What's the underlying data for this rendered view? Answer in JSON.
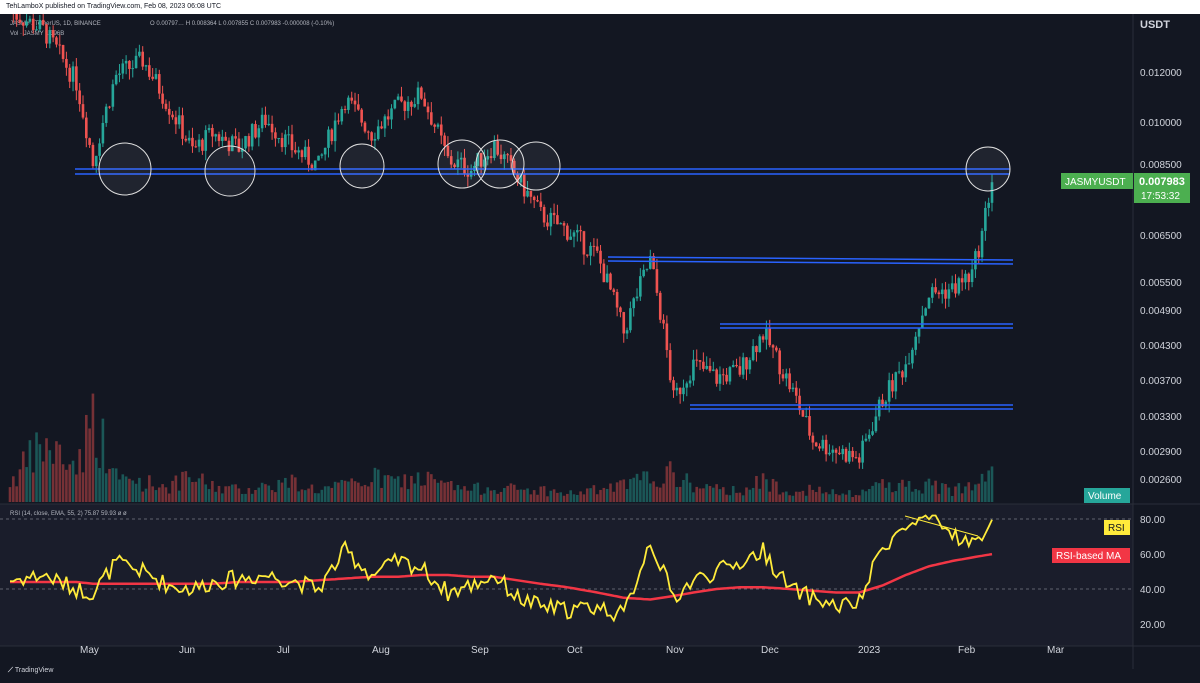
{
  "header": {
    "publisher": "TehLamboX published on TradingView.com, Feb 08, 2023 06:08 UTC",
    "symbol_line": "JASMY / TetherUS, 1D, BINANCE",
    "ohlc_line": "O 0.00797…  H 0.008364  L 0.007855  C 0.007983  -0.000008 (-0.10%)",
    "vol_line": "Vol · JASMY  1.396B",
    "currency": "USDT"
  },
  "price_axis": {
    "labels": [
      "0.012000",
      "0.010000",
      "0.008500",
      "0.006500",
      "0.005500",
      "0.004900",
      "0.004300",
      "0.003700",
      "0.003300",
      "0.002900",
      "0.002600"
    ]
  },
  "badges": {
    "symbol": "JASMYUSDT",
    "price": "0.007983",
    "countdown": "17:53:32",
    "volume": "Volume",
    "rsi": "RSI",
    "rsi_ma": "RSI-based MA",
    "symbol_color": "#4caf50",
    "volume_color": "#26a69a",
    "rsi_color": "#ffeb3b",
    "rsi_ma_color": "#f23645"
  },
  "rsi_header": "RSI (14, close, EMA, 55, 2)  75.87  59.93  ø  ø",
  "rsi_axis": {
    "labels": [
      "80.00",
      "60.00",
      "40.00",
      "20.00"
    ]
  },
  "time_axis": {
    "labels": [
      "May",
      "Jun",
      "Jul",
      "Aug",
      "Sep",
      "Oct",
      "Nov",
      "Dec",
      "2023",
      "Feb",
      "Mar"
    ]
  },
  "footer": {
    "brand": "TradingView"
  },
  "chart_data": {
    "type": "candlestick",
    "title": "JASMY / TetherUS, 1D, BINANCE",
    "price_scale": "log",
    "x": [
      "2022-04-18",
      "2022-04-28",
      "2022-05-08",
      "2022-05-13",
      "2022-05-20",
      "2022-05-28",
      "2022-06-05",
      "2022-06-12",
      "2022-06-18",
      "2022-06-26",
      "2022-07-04",
      "2022-07-12",
      "2022-07-20",
      "2022-07-28",
      "2022-08-05",
      "2022-08-13",
      "2022-08-20",
      "2022-08-28",
      "2022-09-04",
      "2022-09-11",
      "2022-09-18",
      "2022-09-25",
      "2022-10-03",
      "2022-10-12",
      "2022-10-20",
      "2022-10-28",
      "2022-11-04",
      "2022-11-10",
      "2022-11-17",
      "2022-11-24",
      "2022-12-01",
      "2022-12-09",
      "2022-12-16",
      "2022-12-23",
      "2022-12-30",
      "2023-01-06",
      "2023-01-13",
      "2023-01-20",
      "2023-01-27",
      "2023-02-02",
      "2023-02-05",
      "2023-02-08"
    ],
    "close": [
      0.015,
      0.014,
      0.0115,
      0.0085,
      0.0118,
      0.0125,
      0.0105,
      0.0089,
      0.0095,
      0.009,
      0.01,
      0.009,
      0.0084,
      0.0108,
      0.0095,
      0.0105,
      0.011,
      0.0086,
      0.0083,
      0.0091,
      0.008,
      0.007,
      0.0066,
      0.006,
      0.0045,
      0.0059,
      0.0035,
      0.004,
      0.0038,
      0.0039,
      0.0045,
      0.0037,
      0.003,
      0.0029,
      0.0028,
      0.0035,
      0.004,
      0.0052,
      0.0053,
      0.0056,
      0.0065,
      0.008
    ],
    "volume": [
      0.5,
      1.4,
      0.9,
      2.1,
      0.6,
      0.5,
      0.4,
      0.6,
      0.4,
      0.3,
      0.4,
      0.5,
      0.3,
      0.4,
      0.6,
      0.5,
      0.6,
      0.4,
      0.3,
      0.4,
      0.3,
      0.3,
      0.2,
      0.3,
      0.4,
      0.6,
      0.7,
      0.4,
      0.3,
      0.3,
      0.5,
      0.3,
      0.3,
      0.2,
      0.2,
      0.5,
      0.4,
      0.4,
      0.3,
      0.5,
      1.0,
      0.9
    ],
    "rsi": [
      45,
      48,
      40,
      38,
      55,
      50,
      42,
      40,
      44,
      46,
      48,
      45,
      40,
      62,
      48,
      56,
      52,
      38,
      42,
      48,
      35,
      30,
      28,
      30,
      25,
      68,
      35,
      45,
      50,
      55,
      62,
      40,
      35,
      30,
      32,
      65,
      75,
      80,
      72,
      65,
      72,
      75.87
    ],
    "rsi_ma": [
      44,
      44,
      44,
      43,
      43,
      43,
      43,
      43,
      43,
      44,
      44,
      44,
      45,
      46,
      47,
      47,
      48,
      48,
      47,
      47,
      45,
      43,
      41,
      38,
      35,
      34,
      36,
      38,
      40,
      41,
      41,
      40,
      39,
      38,
      38,
      42,
      48,
      53,
      56,
      58,
      59,
      59.93
    ],
    "support_resistance_levels": [
      0.0084,
      0.006,
      0.0047,
      0.0034
    ],
    "highlighted_touches": [
      "2022-05-13",
      "2022-06-12",
      "2022-07-28",
      "2022-09-01",
      "2022-09-08",
      "2022-09-15",
      "2023-02-08"
    ],
    "rsi_levels": [
      80,
      60,
      40,
      20
    ]
  }
}
